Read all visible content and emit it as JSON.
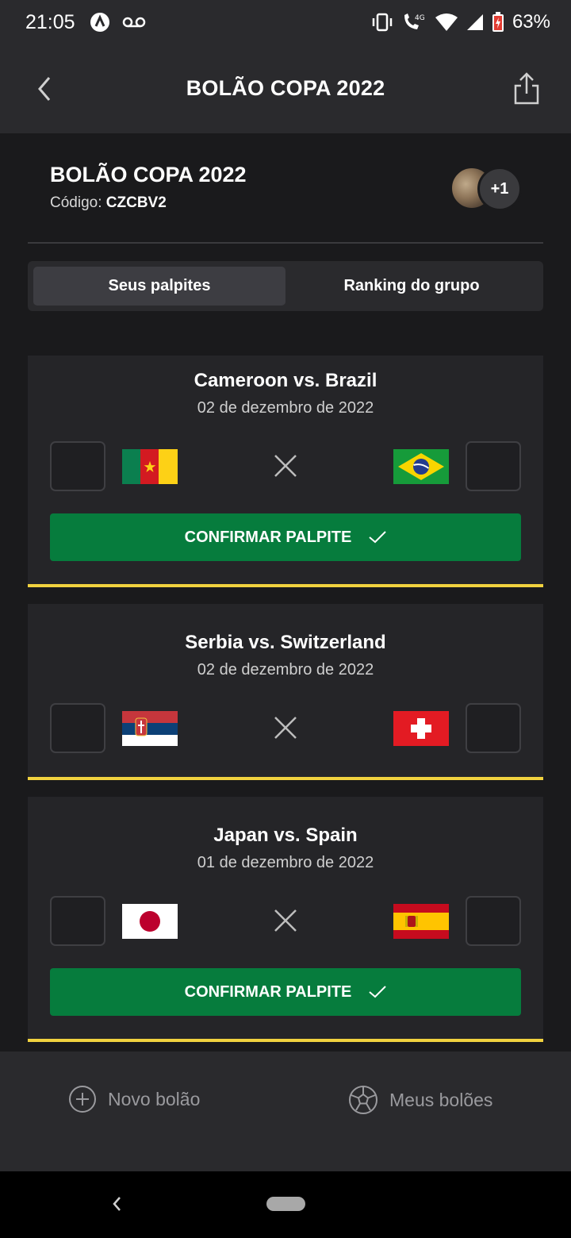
{
  "status_bar": {
    "time": "21:05",
    "battery": "63%"
  },
  "header": {
    "title": "BOLÃO COPA 2022"
  },
  "group": {
    "name": "BOLÃO COPA 2022",
    "code_label": "Código:",
    "code_value": "CZCBV2",
    "extra_members": "+1"
  },
  "tabs": [
    {
      "label": "Seus palpites",
      "active": true
    },
    {
      "label": "Ranking do grupo",
      "active": false
    }
  ],
  "matches": [
    {
      "title": "Cameroon vs. Brazil",
      "date": "02 de dezembro de 2022",
      "home_flag": "cameroon-flag",
      "away_flag": "brazil-flag",
      "button": "CONFIRMAR PALPITE"
    },
    {
      "title": "Serbia vs. Switzerland",
      "date": "02 de dezembro de 2022",
      "home_flag": "serbia-flag",
      "away_flag": "switzerland-flag"
    },
    {
      "title": "Japan vs. Spain",
      "date": "01 de dezembro de 2022",
      "home_flag": "japan-flag",
      "away_flag": "spain-flag",
      "button": "CONFIRMAR PALPITE"
    }
  ],
  "bottom_nav": {
    "new_pool": "Novo bolão",
    "my_pools": "Meus bolões"
  },
  "colors": {
    "background": "#1a1a1c",
    "card": "#252528",
    "confirm_button": "#067c3d",
    "card_accent": "#f1d23f"
  }
}
